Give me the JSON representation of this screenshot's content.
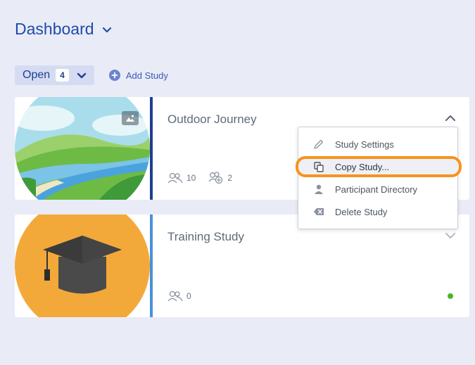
{
  "header": {
    "title": "Dashboard"
  },
  "toolbar": {
    "filter_label": "Open",
    "filter_count": "4",
    "add_study_label": "Add Study"
  },
  "studies": [
    {
      "name": "Outdoor Journey",
      "participants": "10",
      "invited": "2",
      "accent_color": "#1e3f8f",
      "expanded": true
    },
    {
      "name": "Training Study",
      "participants": "0",
      "accent_color": "#4a90d9",
      "status_color": "#49b629",
      "expanded": false
    }
  ],
  "menu": {
    "items": [
      {
        "label": "Study Settings",
        "icon": "pencil-icon"
      },
      {
        "label": "Copy Study...",
        "icon": "copy-icon",
        "highlighted": true
      },
      {
        "label": "Participant Directory",
        "icon": "person-icon"
      },
      {
        "label": "Delete Study",
        "icon": "delete-icon"
      }
    ]
  }
}
